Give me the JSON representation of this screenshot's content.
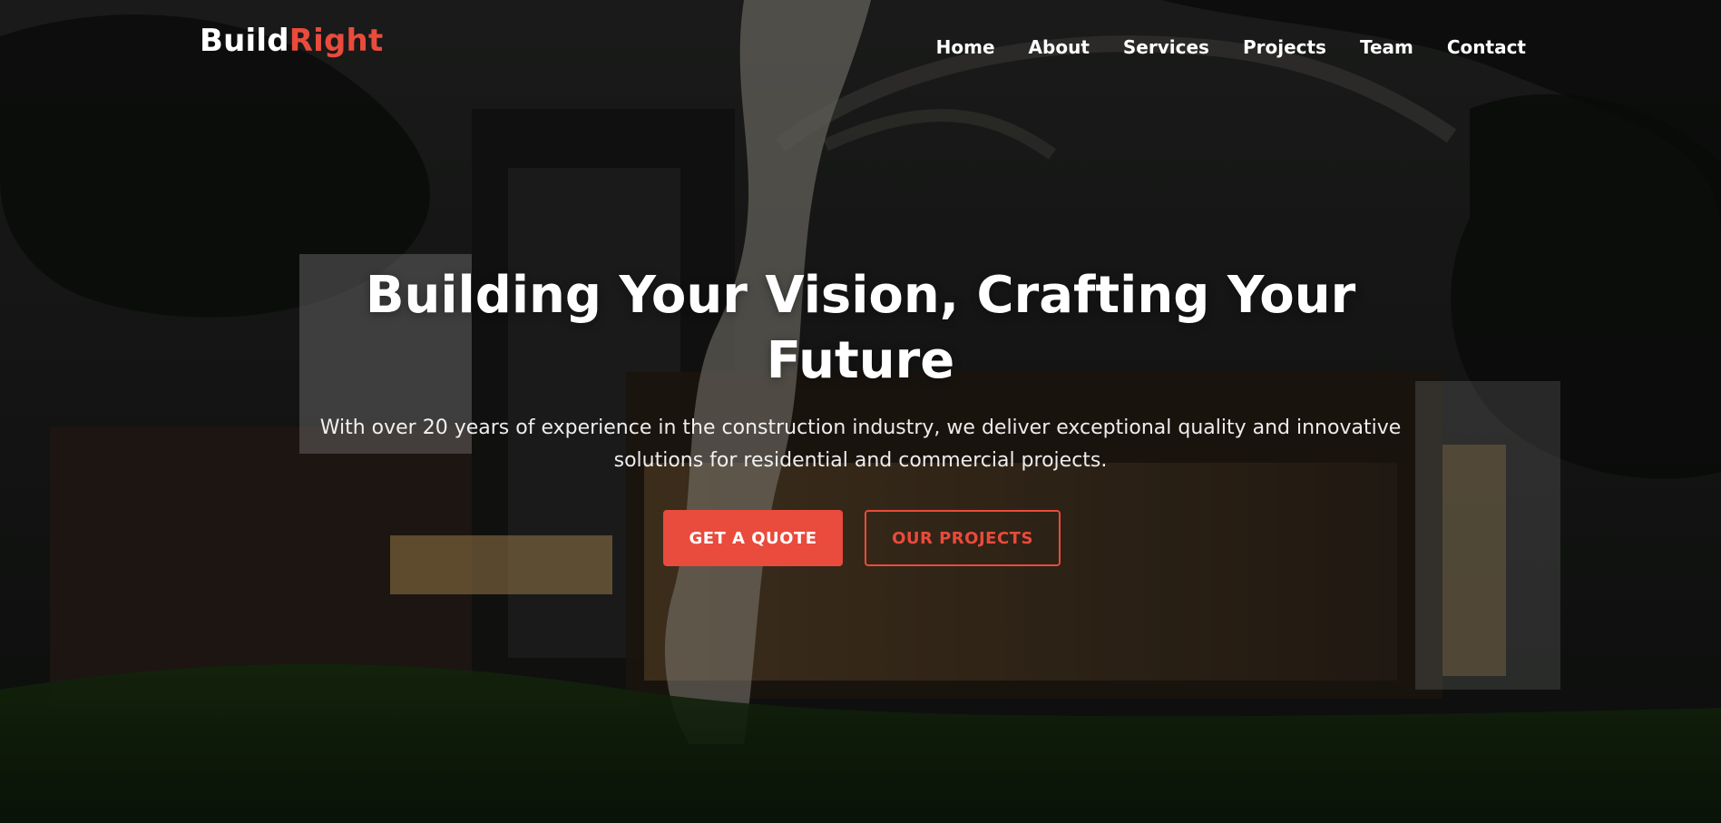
{
  "brand": {
    "name_primary": "Build",
    "name_accent": "Right",
    "accent_color": "#e94b3c"
  },
  "nav": {
    "items": [
      {
        "label": "Home"
      },
      {
        "label": "About"
      },
      {
        "label": "Services"
      },
      {
        "label": "Projects"
      },
      {
        "label": "Team"
      },
      {
        "label": "Contact"
      }
    ]
  },
  "hero": {
    "headline": "Building Your Vision, Crafting Your Future",
    "subtext": "With over 20 years of experience in the construction industry, we deliver exceptional quality and innovative solutions for residential and commercial projects.",
    "cta_primary": "GET A QUOTE",
    "cta_secondary": "OUR PROJECTS"
  }
}
